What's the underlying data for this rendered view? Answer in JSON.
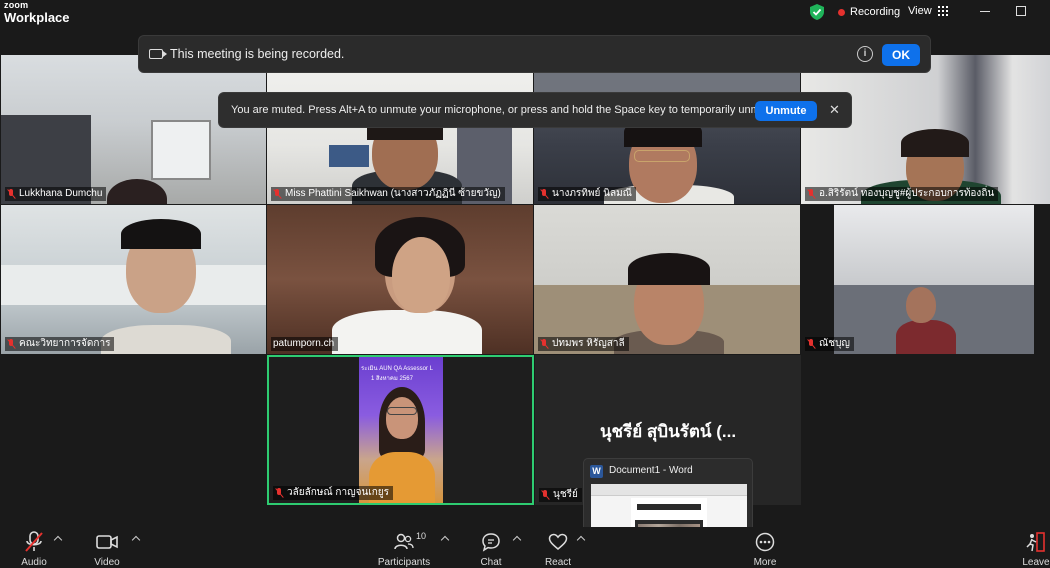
{
  "app": {
    "brand_top": "zoom",
    "brand_bottom": "Workplace"
  },
  "titlebar": {
    "recording_label": "Recording",
    "view_label": "View"
  },
  "recording_banner": {
    "message": "This meeting is being recorded.",
    "ok_label": "OK",
    "info_glyph": "i"
  },
  "mute_banner": {
    "message": "You are muted. Press Alt+A to unmute your microphone, or press and hold the Space key to temporarily unmute.",
    "unmute_label": "Unmute",
    "close_glyph": "✕"
  },
  "participants": [
    {
      "name": "Lukkhana Dumchu",
      "muted": true
    },
    {
      "name": "Miss Phattini Saikhwan (นางสาวภัฏฏินี ซ้ายขวัญ)",
      "muted": true
    },
    {
      "name": "นางภรทิพย์ นิลมณี",
      "muted": true
    },
    {
      "name": "อ.สิริรัตน์ ทองบุญชู#ผู้ประกอบการท้องถิ่น",
      "muted": true
    },
    {
      "name": "คณะวิทยาการจัดการ",
      "muted": true
    },
    {
      "name": "patumporn.ch",
      "muted": false
    },
    {
      "name": "ปทมพร หิรัญสาลี",
      "muted": true
    },
    {
      "name": "ณัชบุญ",
      "muted": true
    },
    {
      "name": "วลัยลักษณ์ กาญจนเกยูร",
      "muted": true,
      "active_speaker": true,
      "slide_line1": "ระเมิน AUN QA Assessor L",
      "slide_line2": "1 สิงหาคม 2567"
    },
    {
      "name": "นุชรีย์",
      "muted": true,
      "display_name": "นุชรีย์  สุบินรัตน์ (..."
    }
  ],
  "word_popup": {
    "title": "Document1 - Word",
    "app_letter": "W"
  },
  "toolbar": {
    "audio_label": "Audio",
    "video_label": "Video",
    "participants_label": "Participants",
    "participants_count": "10",
    "chat_label": "Chat",
    "react_label": "React",
    "more_label": "More",
    "leave_label": "Leave"
  },
  "colors": {
    "accent": "#0e71eb",
    "recording_dot": "#e5312e",
    "active_speaker_border": "#2ecc71",
    "shield": "#1fb45a"
  }
}
